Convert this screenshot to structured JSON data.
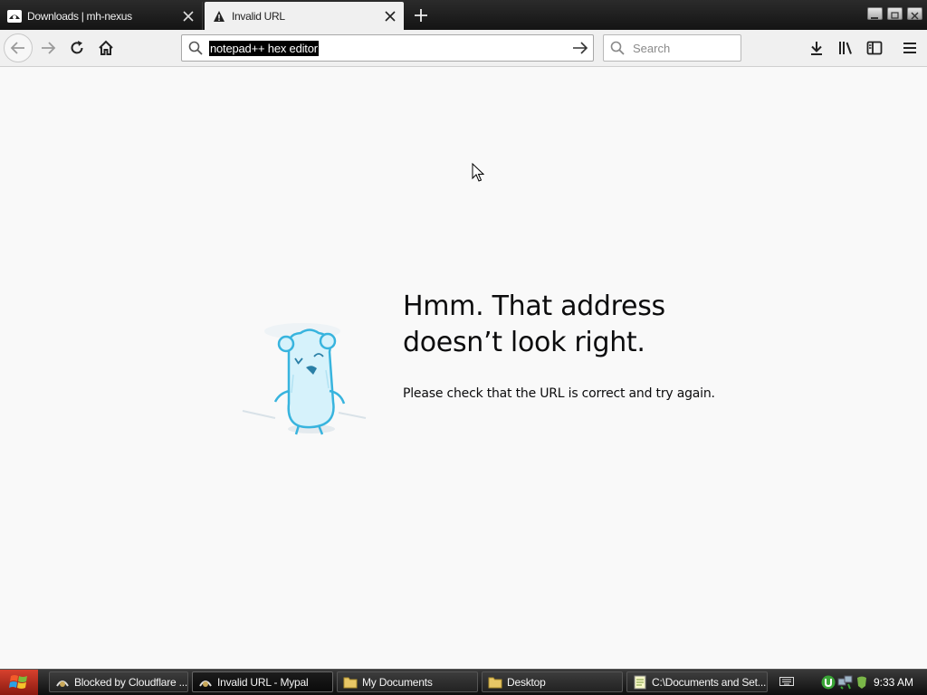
{
  "tabs": [
    {
      "title": "Downloads | mh-nexus",
      "active": false
    },
    {
      "title": "Invalid URL",
      "active": true
    }
  ],
  "urlbar": {
    "value": "notepad++ hex editor"
  },
  "search": {
    "placeholder": "Search"
  },
  "error_page": {
    "heading_line1": "Hmm. That address",
    "heading_line2": "doesn’t look right.",
    "description": "Please check that the URL is correct and try again."
  },
  "taskbar": {
    "items": [
      {
        "label": "Blocked by Cloudflare ...",
        "icon": "browser-icon",
        "active": false
      },
      {
        "label": "Invalid URL - Mypal",
        "icon": "browser-icon",
        "active": true
      },
      {
        "label": "My Documents",
        "icon": "folder-icon",
        "active": false
      },
      {
        "label": "Desktop",
        "icon": "folder-icon",
        "active": false
      },
      {
        "label": "C:\\Documents and Set...",
        "icon": "notepad-icon",
        "active": false
      }
    ],
    "clock": "9:33 AM"
  },
  "colors": {
    "tabstrip": "#1e1e1e",
    "toolbar": "#f0f0f0",
    "page_bg": "#f9f9f9",
    "start_button": "#c0392b"
  }
}
